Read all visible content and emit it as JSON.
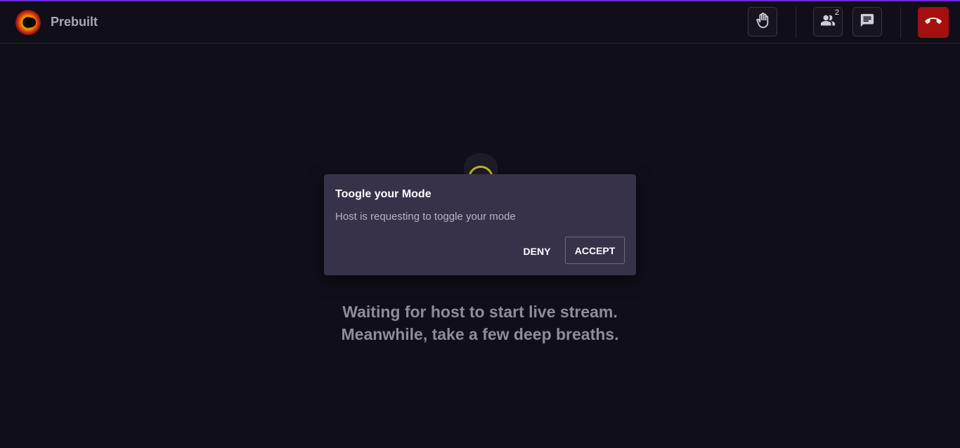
{
  "header": {
    "app_title": "Prebuilt",
    "participants_count": "2",
    "icons": {
      "logo": "app-logo",
      "raise_hand": "hand-icon",
      "participants": "people-icon",
      "chat": "chat-icon",
      "end_call": "phone-hangup-icon"
    }
  },
  "dialog": {
    "title": "Toogle your Mode",
    "message": "Host is requesting to toggle your mode",
    "deny_label": "DENY",
    "accept_label": "ACCEPT"
  },
  "waiting": {
    "line1": "Waiting for host to start live stream.",
    "line2": "Meanwhile, take a few deep breaths."
  },
  "colors": {
    "background": "#100e18",
    "accent": "#6d28d9",
    "dialog_bg": "#37314a",
    "end_call": "#a50f0f"
  }
}
